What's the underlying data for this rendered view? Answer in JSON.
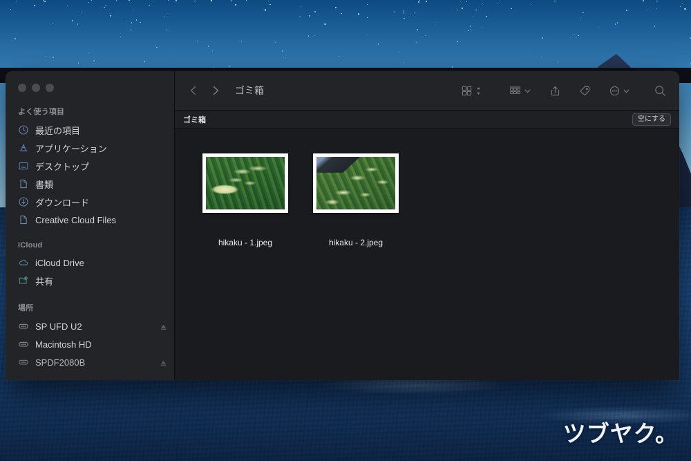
{
  "desktop": {
    "watermark": "ツブヤク。"
  },
  "window": {
    "traffic_lights": [
      "close",
      "minimize",
      "zoom"
    ],
    "toolbar": {
      "back_icon": "chevron-left-icon",
      "forward_icon": "chevron-right-icon",
      "title": "ゴミ箱",
      "view_mode_icon": "icon-view-grid-icon",
      "view_mode_chevron": "chevron-updown-icon",
      "group_icon": "group-by-icon",
      "group_chevron": "chevron-down-icon",
      "share_icon": "share-icon",
      "tag_icon": "tag-icon",
      "more_icon": "more-ellipsis-icon",
      "more_chevron": "chevron-down-icon",
      "search_icon": "search-icon"
    },
    "subbar": {
      "label": "ゴミ箱",
      "empty_button": "空にする"
    }
  },
  "sidebar": {
    "groups": [
      {
        "title": "よく使う項目",
        "items": [
          {
            "label": "最近の項目",
            "icon": "clock-icon",
            "icon_color": "#6d84a6"
          },
          {
            "label": "アプリケーション",
            "icon": "applications-icon",
            "icon_color": "#5f7db0"
          },
          {
            "label": "デスクトップ",
            "icon": "desktop-icon",
            "icon_color": "#5f7db0"
          },
          {
            "label": "書類",
            "icon": "document-icon",
            "icon_color": "#6d84a6"
          },
          {
            "label": "ダウンロード",
            "icon": "download-icon",
            "icon_color": "#6d84a6"
          },
          {
            "label": "Creative Cloud Files",
            "icon": "document-icon",
            "icon_color": "#6d84a6"
          }
        ]
      },
      {
        "title": "iCloud",
        "items": [
          {
            "label": "iCloud Drive",
            "icon": "cloud-icon",
            "icon_color": "#4f8b93"
          },
          {
            "label": "共有",
            "icon": "shared-folder-icon",
            "icon_color": "#4f8b93"
          }
        ]
      },
      {
        "title": "場所",
        "items": [
          {
            "label": "SP UFD U2",
            "icon": "drive-icon",
            "icon_color": "#8b8d93",
            "eject": true
          },
          {
            "label": "Macintosh HD",
            "icon": "drive-icon",
            "icon_color": "#8b8d93",
            "eject": false
          },
          {
            "label": "SPDF2080B",
            "icon": "drive-icon",
            "icon_color": "#8b8d93",
            "eject": true
          }
        ]
      }
    ]
  },
  "files": [
    {
      "name": "hikaku - 1.jpeg",
      "thumb_class": "th1"
    },
    {
      "name": "hikaku - 2.jpeg",
      "thumb_class": "th2"
    }
  ],
  "colors": {
    "sidebar_bg": "#232427",
    "content_bg": "#191b1f",
    "toolbar_bg": "#232427",
    "subbar_bg": "#1e2024",
    "text_primary": "#e9ebee",
    "text_secondary": "#b9bcc1",
    "group_title": "#8b8d93"
  }
}
